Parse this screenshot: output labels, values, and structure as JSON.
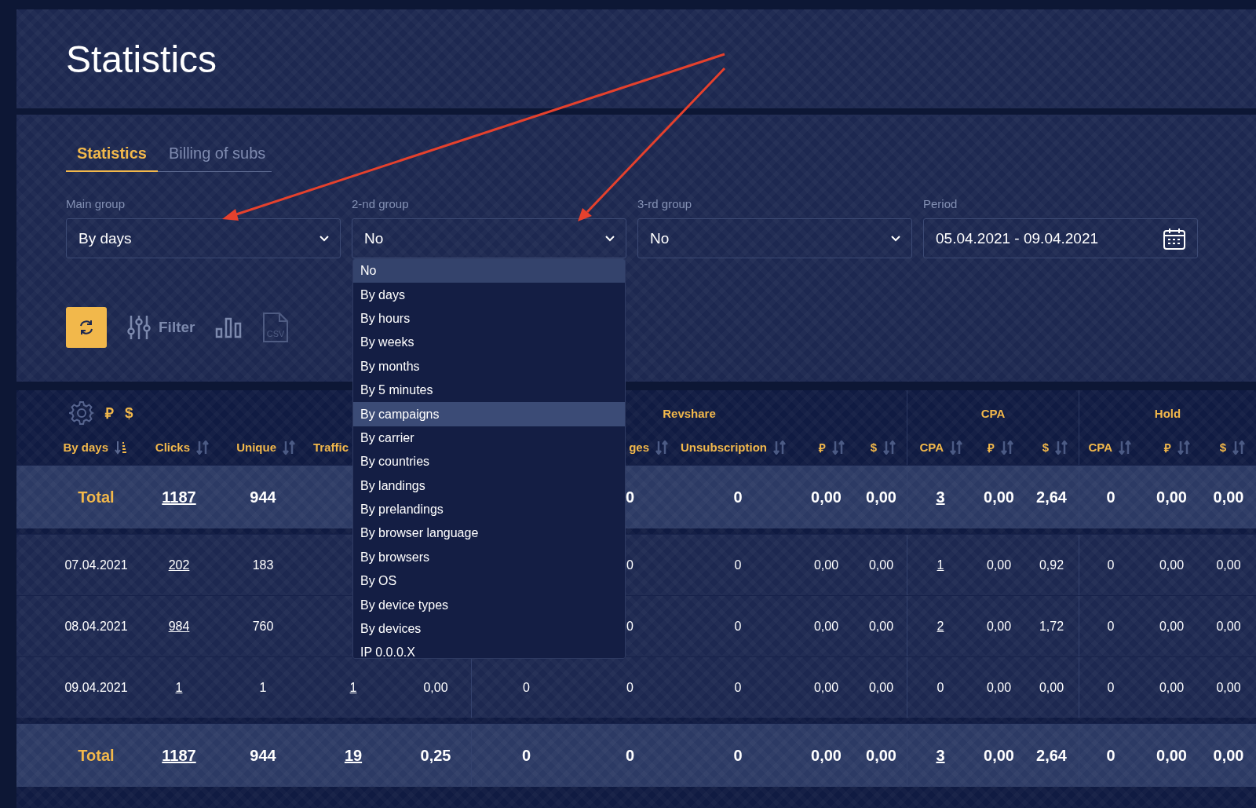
{
  "page_title": "Statistics",
  "tabs": [
    {
      "label": "Statistics",
      "selected": true
    },
    {
      "label": "Billing of subs",
      "selected": false
    }
  ],
  "filters": [
    {
      "label": "Main group",
      "value": "By days",
      "kind": "select"
    },
    {
      "label": "2-nd group",
      "value": "No",
      "kind": "select",
      "options": [
        {
          "label": "No",
          "selected": true,
          "hovered": false
        },
        {
          "label": "By days",
          "selected": false,
          "hovered": false
        },
        {
          "label": "By hours",
          "selected": false,
          "hovered": false
        },
        {
          "label": "By weeks",
          "selected": false,
          "hovered": false
        },
        {
          "label": "By months",
          "selected": false,
          "hovered": false
        },
        {
          "label": "By 5 minutes",
          "selected": false,
          "hovered": false
        },
        {
          "label": "By campaigns",
          "selected": false,
          "hovered": true
        },
        {
          "label": "By carrier",
          "selected": false,
          "hovered": false
        },
        {
          "label": "By countries",
          "selected": false,
          "hovered": false
        },
        {
          "label": "By landings",
          "selected": false,
          "hovered": false
        },
        {
          "label": "By prelandings",
          "selected": false,
          "hovered": false
        },
        {
          "label": "By browser language",
          "selected": false,
          "hovered": false
        },
        {
          "label": "By browsers",
          "selected": false,
          "hovered": false
        },
        {
          "label": "By OS",
          "selected": false,
          "hovered": false
        },
        {
          "label": "By device types",
          "selected": false,
          "hovered": false
        },
        {
          "label": "By devices",
          "selected": false,
          "hovered": false
        },
        {
          "label": "IP 0.0.0.X",
          "selected": false,
          "hovered": false
        }
      ]
    },
    {
      "label": "3-rd group",
      "value": "No",
      "kind": "select"
    },
    {
      "label": "Period",
      "value": "05.04.2021 - 09.04.2021",
      "kind": "date"
    }
  ],
  "toolbar": [
    {
      "kind": "refresh"
    },
    {
      "kind": "filter",
      "label": "Filter"
    },
    {
      "kind": "chart"
    },
    {
      "kind": "csv",
      "label": "CSV"
    }
  ],
  "table": {
    "currencies": [
      "₽",
      "$"
    ],
    "groups": [
      {
        "columns": [
          {
            "label": "By days",
            "sorted": true
          },
          {
            "label": "Clicks",
            "sorted": false
          },
          {
            "label": "Unique",
            "sorted": false
          },
          {
            "label": "Traffic"
          },
          {}
        ]
      },
      {
        "label": "Revshare",
        "columns": [
          {},
          {
            "label": "ges",
            "sorted": false
          },
          {
            "label": "Unsubscription",
            "sorted": false
          },
          {
            "label": "₽",
            "sorted": false
          },
          {
            "label": "$",
            "sorted": false
          }
        ]
      },
      {
        "label": "CPA",
        "columns": [
          {
            "label": "CPA",
            "sorted": false
          },
          {
            "label": "₽",
            "sorted": false
          },
          {
            "label": "$",
            "sorted": false
          }
        ]
      },
      {
        "label": "Hold",
        "columns": [
          {
            "label": "CPA",
            "sorted": false
          },
          {
            "label": "₽",
            "sorted": false
          },
          {
            "label": "$",
            "sorted": false
          }
        ]
      }
    ],
    "rows": [
      {
        "kind": "total",
        "cells": [
          "Total",
          {
            "text": "1187",
            "link": true
          },
          "944",
          null,
          null,
          null,
          "0",
          "0",
          "0,00",
          "0,00",
          {
            "text": "3",
            "link": true
          },
          "0,00",
          "2,64",
          "0",
          "0,00",
          "0,00"
        ]
      },
      {
        "kind": "data",
        "cells": [
          "07.04.2021",
          {
            "text": "202",
            "link": true
          },
          "183",
          null,
          null,
          null,
          "0",
          "0",
          "0,00",
          "0,00",
          {
            "text": "1",
            "link": true
          },
          "0,00",
          "0,92",
          "0",
          "0,00",
          "0,00"
        ]
      },
      {
        "kind": "data",
        "cells": [
          "08.04.2021",
          {
            "text": "984",
            "link": true
          },
          "760",
          null,
          null,
          null,
          "0",
          "0",
          "0,00",
          "0,00",
          {
            "text": "2",
            "link": true
          },
          "0,00",
          "1,72",
          "0",
          "0,00",
          "0,00"
        ]
      },
      {
        "kind": "data",
        "cells": [
          "09.04.2021",
          {
            "text": "1",
            "link": true
          },
          "1",
          {
            "text": "1",
            "link": true
          },
          "0,00",
          "0",
          "0",
          "0",
          "0,00",
          "0,00",
          "0",
          "0,00",
          "0,00",
          "0",
          "0,00",
          "0,00"
        ]
      },
      {
        "kind": "total",
        "cells": [
          "Total",
          {
            "text": "1187",
            "link": true
          },
          "944",
          {
            "text": "19",
            "link": true
          },
          "0,25",
          "0",
          "0",
          "0",
          "0,00",
          "0,00",
          {
            "text": "3",
            "link": true
          },
          "0,00",
          "2,64",
          "0",
          "0,00",
          "0,00"
        ]
      }
    ]
  }
}
